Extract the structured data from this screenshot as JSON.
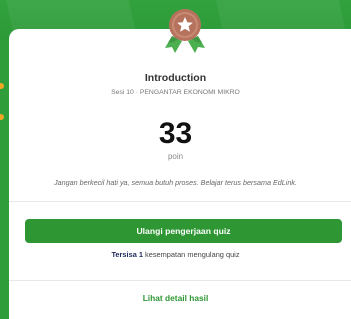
{
  "quiz": {
    "title": "Introduction",
    "session": "Sesi 10 · PENGANTAR EKONOMI MIKRO",
    "score": "33",
    "score_unit": "poin",
    "message": "Jangan berkecil hati ya, semua butuh proses. Belajar terus bersama EdLink."
  },
  "actions": {
    "retry_label": "Ulangi pengerjaan quiz",
    "remaining_prefix": "Tersisa 1",
    "remaining_suffix": " kesempatan mengulang quiz",
    "detail_label": "Lihat detail hasil"
  },
  "colors": {
    "brand_green": "#2e9633",
    "background_green": "#2e9d3a",
    "medal_bronze": "#b5735e",
    "ribbon_green": "#4caf50"
  },
  "icons": {
    "medal": "medal-star-icon"
  }
}
